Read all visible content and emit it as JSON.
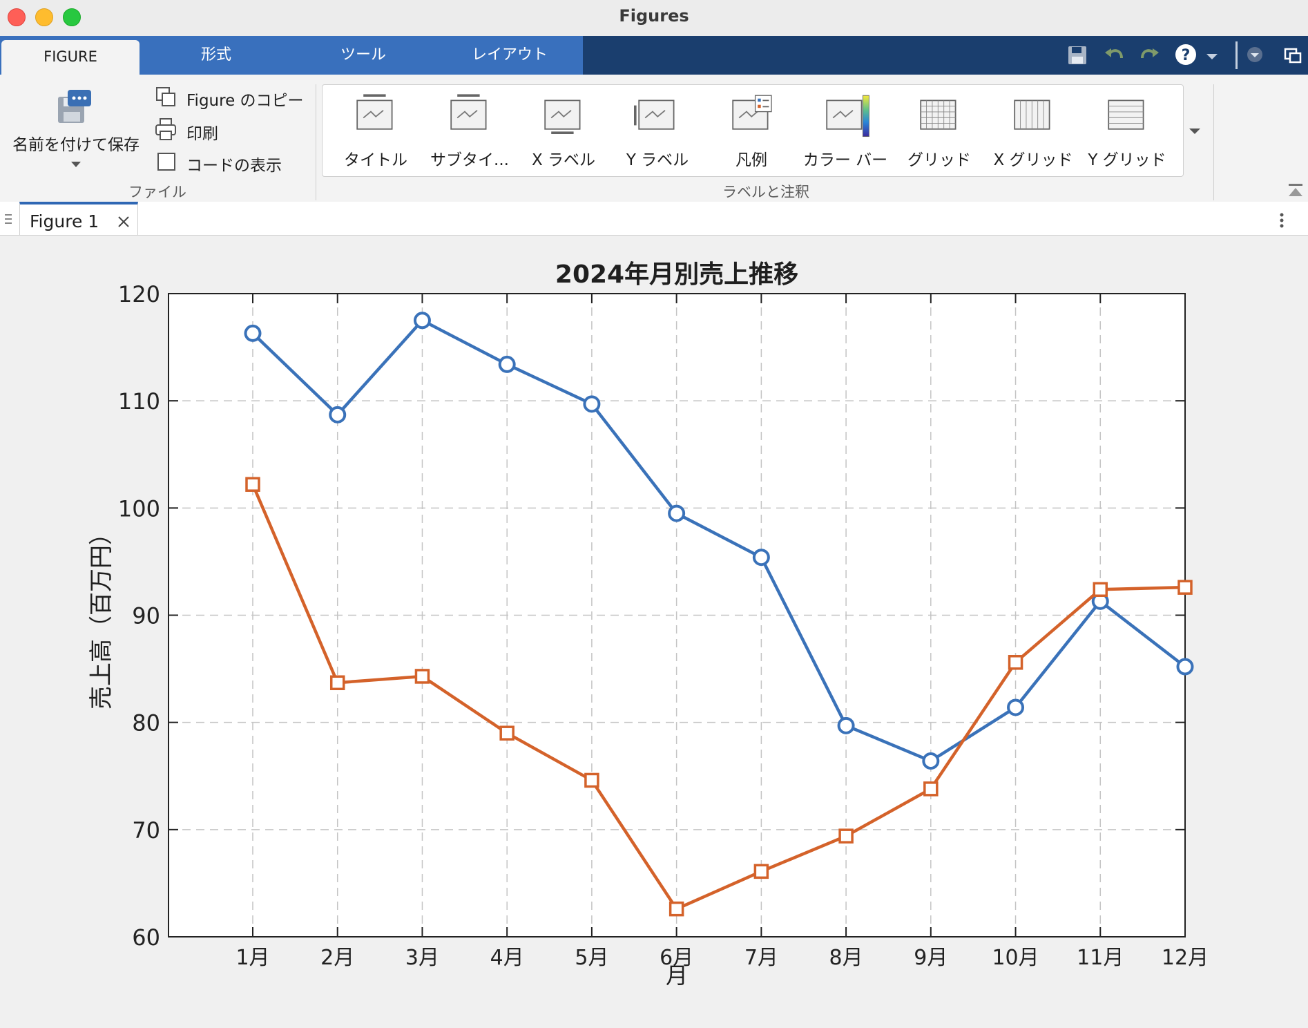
{
  "window": {
    "title": "Figures"
  },
  "ribbon_tabs": [
    {
      "label": "FIGURE",
      "active": true
    },
    {
      "label": "形式"
    },
    {
      "label": "ツール"
    },
    {
      "label": "レイアウト"
    }
  ],
  "quick_access": [
    {
      "icon": "save-icon"
    },
    {
      "icon": "undo-icon"
    },
    {
      "icon": "redo-icon"
    },
    {
      "icon": "help-icon"
    }
  ],
  "file_group": {
    "label": "ファイル",
    "save_as": "名前を付けて保存",
    "copy_figure": "Figure のコピー",
    "print": "印刷",
    "show_code": "コードの表示"
  },
  "labels_group": {
    "label": "ラベルと注釈",
    "items": [
      "タイトル",
      "サブタイ...",
      "X ラベル",
      "Y ラベル",
      "凡例",
      "カラー バー",
      "グリッド",
      "X グリッド",
      "Y グリッド"
    ]
  },
  "document": {
    "tab_label": "Figure 1"
  },
  "colors": {
    "series1": "#3a72b9",
    "series2": "#d4622a",
    "ribbon_blue": "#3970bd",
    "ribbon_dark": "#1a3e6e"
  },
  "chart_data": {
    "type": "line",
    "title": "2024年月別売上推移",
    "xlabel": "月",
    "ylabel": "売上高（百万円）",
    "categories": [
      "1月",
      "2月",
      "3月",
      "4月",
      "5月",
      "6月",
      "7月",
      "8月",
      "9月",
      "10月",
      "11月",
      "12月"
    ],
    "ylim": [
      60,
      120
    ],
    "yticks": [
      60,
      70,
      80,
      90,
      100,
      110,
      120
    ],
    "grid": true,
    "series": [
      {
        "marker": "circle",
        "color": "#3a72b9",
        "values": [
          116.3,
          108.7,
          117.5,
          113.4,
          109.7,
          99.5,
          95.4,
          79.7,
          76.4,
          81.4,
          91.3,
          85.2
        ]
      },
      {
        "marker": "square",
        "color": "#d4622a",
        "values": [
          102.2,
          83.7,
          84.3,
          79.0,
          74.6,
          62.6,
          66.1,
          69.4,
          73.8,
          85.6,
          92.4,
          92.6
        ]
      }
    ]
  }
}
